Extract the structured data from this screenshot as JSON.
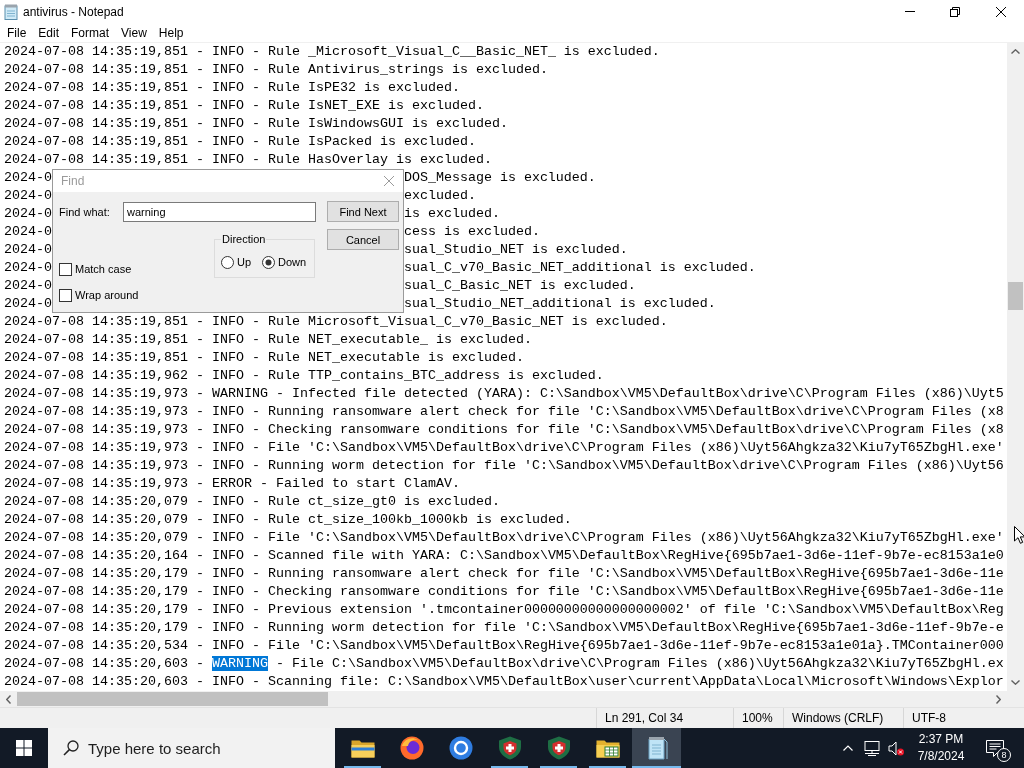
{
  "window": {
    "title": "antivirus - Notepad"
  },
  "menu": [
    "File",
    "Edit",
    "Format",
    "View",
    "Help"
  ],
  "editor": {
    "lines": [
      {
        "kind": "plain",
        "text": "2024-07-08 14:35:19,851 - INFO - Rule _Microsoft_Visual_C__Basic_NET_ is excluded."
      },
      {
        "kind": "plain",
        "text": "2024-07-08 14:35:19,851 - INFO - Rule Antivirus_strings is excluded."
      },
      {
        "kind": "plain",
        "text": "2024-07-08 14:35:19,851 - INFO - Rule IsPE32 is excluded."
      },
      {
        "kind": "plain",
        "text": "2024-07-08 14:35:19,851 - INFO - Rule IsNET_EXE is excluded."
      },
      {
        "kind": "plain",
        "text": "2024-07-08 14:35:19,851 - INFO - Rule IsWindowsGUI is excluded."
      },
      {
        "kind": "plain",
        "text": "2024-07-08 14:35:19,851 - INFO - Rule IsPacked is excluded."
      },
      {
        "kind": "plain",
        "text": "2024-07-08 14:35:19,851 - INFO - Rule HasOverlay is excluded."
      },
      {
        "kind": "covered",
        "left": "2024-0",
        "right": "DOS_Message is excluded."
      },
      {
        "kind": "covered",
        "left": "2024-0",
        "right": "excluded."
      },
      {
        "kind": "covered",
        "left": "2024-0",
        "right": "is excluded."
      },
      {
        "kind": "covered",
        "left": "2024-0",
        "right": "cess is excluded."
      },
      {
        "kind": "covered",
        "left": "2024-0",
        "right": "sual_Studio_NET is excluded."
      },
      {
        "kind": "covered",
        "left": "2024-0",
        "right": "sual_C_v70_Basic_NET_additional is excluded."
      },
      {
        "kind": "covered",
        "left": "2024-0",
        "right": "sual_C_Basic_NET is excluded."
      },
      {
        "kind": "covered",
        "left": "2024-0",
        "right": "sual_Studio_NET_additional is excluded."
      },
      {
        "kind": "plain",
        "text": "2024-07-08 14:35:19,851 - INFO - Rule Microsoft_Visual_C_v70_Basic_NET is excluded."
      },
      {
        "kind": "plain",
        "text": "2024-07-08 14:35:19,851 - INFO - Rule NET_executable_ is excluded."
      },
      {
        "kind": "plain",
        "text": "2024-07-08 14:35:19,851 - INFO - Rule NET_executable is excluded."
      },
      {
        "kind": "plain",
        "text": "2024-07-08 14:35:19,962 - INFO - Rule TTP_contains_BTC_address is excluded."
      },
      {
        "kind": "plain",
        "text": "2024-07-08 14:35:19,973 - WARNING - Infected file detected (YARA): C:\\Sandbox\\VM5\\DefaultBox\\drive\\C\\Program Files (x86)\\Uyt5"
      },
      {
        "kind": "plain",
        "text": "2024-07-08 14:35:19,973 - INFO - Running ransomware alert check for file 'C:\\Sandbox\\VM5\\DefaultBox\\drive\\C\\Program Files (x8"
      },
      {
        "kind": "plain",
        "text": "2024-07-08 14:35:19,973 - INFO - Checking ransomware conditions for file 'C:\\Sandbox\\VM5\\DefaultBox\\drive\\C\\Program Files (x8"
      },
      {
        "kind": "plain",
        "text": "2024-07-08 14:35:19,973 - INFO - File 'C:\\Sandbox\\VM5\\DefaultBox\\drive\\C\\Program Files (x86)\\Uyt56Ahgkza32\\Kiu7yT65ZbgHl.exe'"
      },
      {
        "kind": "plain",
        "text": "2024-07-08 14:35:19,973 - INFO - Running worm detection for file 'C:\\Sandbox\\VM5\\DefaultBox\\drive\\C\\Program Files (x86)\\Uyt56"
      },
      {
        "kind": "plain",
        "text": "2024-07-08 14:35:19,973 - ERROR - Failed to start ClamAV."
      },
      {
        "kind": "plain",
        "text": "2024-07-08 14:35:20,079 - INFO - Rule ct_size_gt0 is excluded."
      },
      {
        "kind": "plain",
        "text": "2024-07-08 14:35:20,079 - INFO - Rule ct_size_100kb_1000kb is excluded."
      },
      {
        "kind": "plain",
        "text": "2024-07-08 14:35:20,079 - INFO - File 'C:\\Sandbox\\VM5\\DefaultBox\\drive\\C\\Program Files (x86)\\Uyt56Ahgkza32\\Kiu7yT65ZbgHl.exe'"
      },
      {
        "kind": "plain",
        "text": "2024-07-08 14:35:20,164 - INFO - Scanned file with YARA: C:\\Sandbox\\VM5\\DefaultBox\\RegHive{695b7ae1-3d6e-11ef-9b7e-ec8153a1e0"
      },
      {
        "kind": "plain",
        "text": "2024-07-08 14:35:20,179 - INFO - Running ransomware alert check for file 'C:\\Sandbox\\VM5\\DefaultBox\\RegHive{695b7ae1-3d6e-11e"
      },
      {
        "kind": "plain",
        "text": "2024-07-08 14:35:20,179 - INFO - Checking ransomware conditions for file 'C:\\Sandbox\\VM5\\DefaultBox\\RegHive{695b7ae1-3d6e-11e"
      },
      {
        "kind": "plain",
        "text": "2024-07-08 14:35:20,179 - INFO - Previous extension '.tmcontainer00000000000000000002' of file 'C:\\Sandbox\\VM5\\DefaultBox\\Reg"
      },
      {
        "kind": "plain",
        "text": "2024-07-08 14:35:20,179 - INFO - Running worm detection for file 'C:\\Sandbox\\VM5\\DefaultBox\\RegHive{695b7ae1-3d6e-11ef-9b7e-e"
      },
      {
        "kind": "plain",
        "text": "2024-07-08 14:35:20,534 - INFO - File 'C:\\Sandbox\\VM5\\DefaultBox\\RegHive{695b7ae1-3d6e-11ef-9b7e-ec8153a1e01a}.TMContainer000"
      },
      {
        "kind": "match",
        "before": "2024-07-08 14:35:20,603 -",
        "match": "WARNING",
        "after": "- File C:\\Sandbox\\VM5\\DefaultBox\\drive\\C\\Program Files (x86)\\Uyt56Ahgkza32\\Kiu7yT65ZbgHl.ex"
      },
      {
        "kind": "plain",
        "text": "2024-07-08 14:35:20,603 - INFO - Scanning file: C:\\Sandbox\\VM5\\DefaultBox\\user\\current\\AppData\\Local\\Microsoft\\Windows\\Explor"
      }
    ]
  },
  "find_dialog": {
    "title": "Find",
    "find_what": {
      "label": "Find what:",
      "value": "warning"
    },
    "buttons": [
      "Find Next",
      "Cancel"
    ],
    "direction": {
      "label": "Direction",
      "options": [
        {
          "label": "Up",
          "selected": false
        },
        {
          "label": "Down",
          "selected": true
        }
      ]
    },
    "options": [
      {
        "label": "Match case",
        "checked": false
      },
      {
        "label": "Wrap around",
        "checked": false
      }
    ]
  },
  "status_bar": [
    "Ln 291, Col 34",
    "100%",
    "Windows (CRLF)",
    "UTF-8"
  ],
  "taskbar": {
    "search": {
      "placeholder": "Type here to search"
    },
    "apps": [
      {
        "kind": "folder",
        "running": true,
        "selected": false
      },
      {
        "kind": "fox",
        "running": false,
        "selected": false
      },
      {
        "kind": "ring",
        "running": false,
        "selected": false
      },
      {
        "kind": "shield",
        "running": true,
        "selected": false
      },
      {
        "kind": "shield",
        "running": true,
        "selected": false
      },
      {
        "kind": "table",
        "running": true,
        "selected": false
      },
      {
        "kind": "notepad",
        "running": true,
        "selected": true
      }
    ],
    "clock": {
      "time": "2:37 PM",
      "date": "7/8/2024"
    },
    "notifications": {
      "count": "8"
    }
  }
}
